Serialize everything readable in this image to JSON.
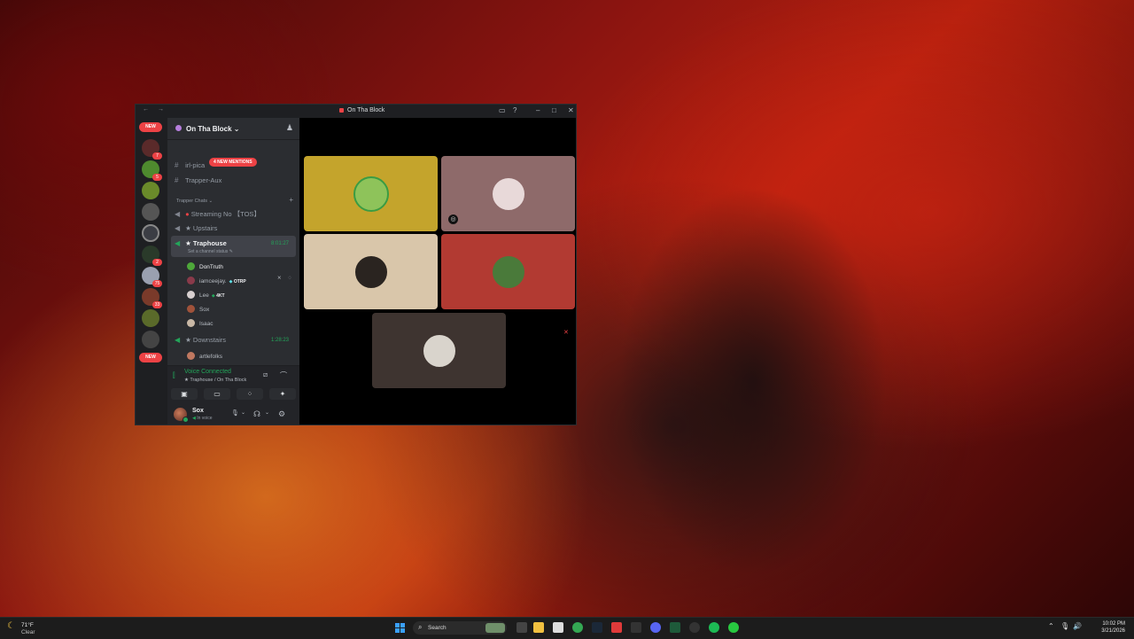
{
  "window": {
    "title": "On Tha Block",
    "nav": "← →",
    "controls": {
      "inbox": "▭",
      "help": "?",
      "minimize": "–",
      "maximize": "□",
      "close": "✕"
    }
  },
  "guild_bar": {
    "new_top": "NEW",
    "new_bottom": "NEW",
    "badges": [
      "7",
      "5",
      "2",
      "75",
      "33"
    ]
  },
  "server": {
    "name": "On Tha Block",
    "chevron": "⌄",
    "invite_icon": "♟"
  },
  "mentions_pill": "4 NEW MENTIONS",
  "channels": {
    "partial_top": "irl-pica",
    "trapper_aux": "Trapper-Aux",
    "category": "Trapper Chats",
    "category_chevron": "⌄",
    "category_plus": "+",
    "streaming": "Streaming No 【TOS】",
    "upstairs": "★ Upstairs",
    "traphouse": "★ Traphouse",
    "traphouse_timer": "8:01:27",
    "traphouse_status": "Set a channel status",
    "downstairs": "★ Downstairs",
    "downstairs_timer": "1:28:23"
  },
  "members": {
    "traphouse": [
      {
        "name": "DonTruth",
        "tag": "",
        "tag_gem": ""
      },
      {
        "name": "iamceejay.",
        "tag": "OTRP",
        "tag_gem": "◆"
      },
      {
        "name": "Lee",
        "tag": "4KT",
        "tag_gem": "◆"
      },
      {
        "name": "Sox",
        "tag": "",
        "tag_gem": ""
      },
      {
        "name": "Isaac",
        "tag": "",
        "tag_gem": ""
      }
    ],
    "downstairs": [
      {
        "name": "artlefolks"
      }
    ],
    "icons": "⨯ ◌"
  },
  "voice": {
    "title": "Voice Connected",
    "subtitle": "★ Traphouse / On Tha Block",
    "signal_icon": "⫿",
    "noise_icon": "⧄",
    "disconnect_icon": "⌒",
    "buttons": [
      "▣",
      "▭",
      "⁘",
      "✦"
    ]
  },
  "user": {
    "name": "Sox",
    "state": "In voice",
    "mic_icon": "🎙",
    "headset_icon": "☊",
    "settings_icon": "⚙",
    "chevron": "⌄"
  },
  "tiles": [
    {
      "bg": "#c4a42c",
      "circle": "#8ec35a",
      "ring": "#3a9c43",
      "icon": ""
    },
    {
      "bg": "#8e6a6a",
      "circle": "#e8d9d9",
      "ring": "#8e6a6a",
      "icon": "◎"
    },
    {
      "bg": "#d9c6aa",
      "circle": "#2a2420",
      "ring": "#d9c6aa",
      "icon": ""
    },
    {
      "bg": "#b23a32",
      "circle": "#4a7a3a",
      "ring": "#b23a32",
      "icon": ""
    },
    {
      "bg": "#3e3430",
      "circle": "#d9d4cc",
      "ring": "#3e3430",
      "icon": ""
    }
  ],
  "stage_close": "✕",
  "taskbar": {
    "temp": "71°F",
    "condition": "Clear",
    "search": "Search",
    "time": "10:02 PM",
    "date": "3/21/2026",
    "tray": [
      "⌃",
      "🎙",
      "🔊"
    ]
  }
}
